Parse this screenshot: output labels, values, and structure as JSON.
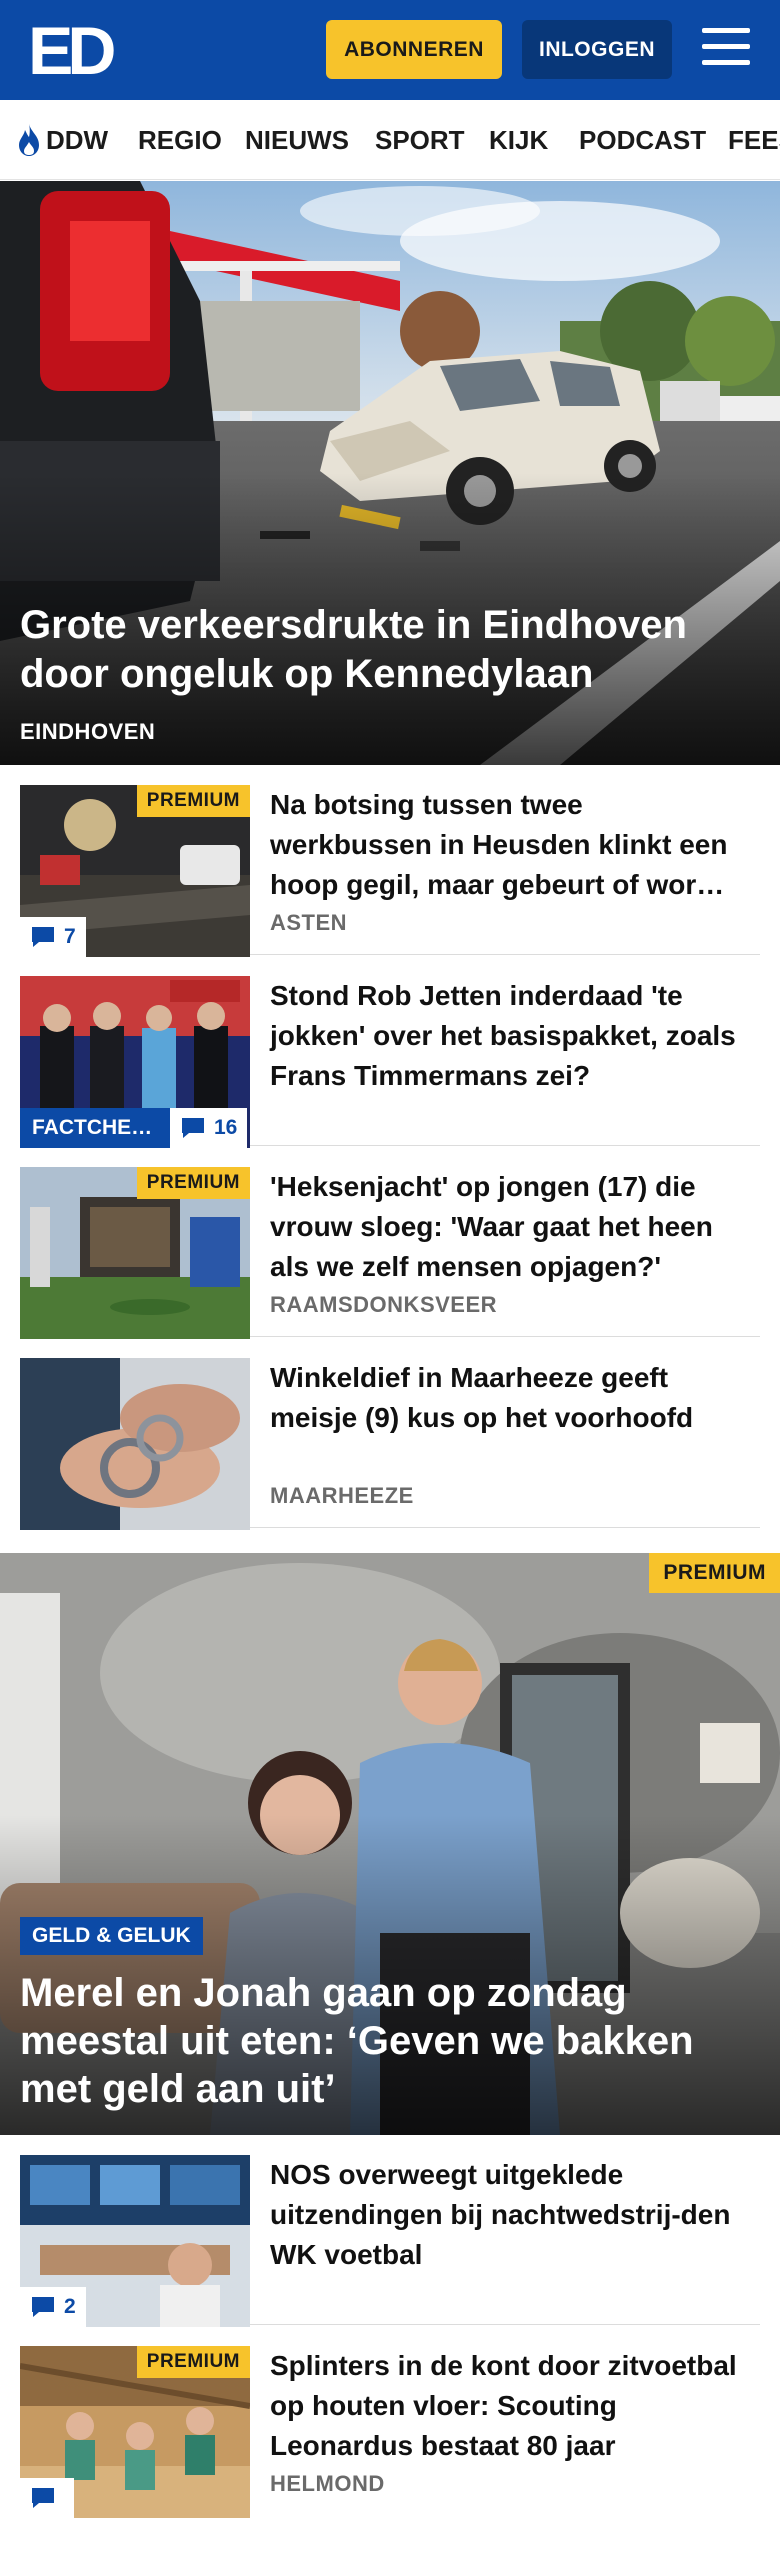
{
  "header": {
    "logo_text": "ED",
    "subscribe_label": "ABONNEREN",
    "login_label": "INLOGGEN"
  },
  "nav": {
    "items": [
      "DDW",
      "REGIO",
      "NIEUWS",
      "SPORT",
      "KIJK",
      "PODCAST",
      "FEEST"
    ]
  },
  "hero": {
    "title": "Grote verkeersdrukte in Eindhoven door ongeluk op Kennedylaan",
    "kicker": "EINDHOVEN"
  },
  "articles": [
    {
      "title": "Na botsing tussen twee werkbussen in Heusden klinkt een hoop gegil, maar gebeurt of wordt er weinig gedaan",
      "location": "ASTEN",
      "premium": "PREMIUM",
      "comments": "7"
    },
    {
      "title": "Stond Rob Jetten inderdaad 'te jokken' over het basispakket, zoals Frans Timmermans zei?",
      "location": "",
      "label": "FACTCHECK",
      "comments": "16"
    },
    {
      "title": "'Heksenjacht' op jongen (17) die vrouw sloeg: 'Waar gaat het heen als we zelf mensen opjagen?'",
      "location": "RAAMSDONKSVEER",
      "premium": "PREMIUM"
    },
    {
      "title": "Winkeldief in Maarheeze geeft meisje (9) kus op het voorhoofd",
      "location": "MAARHEEZE"
    }
  ],
  "feature": {
    "premium": "PREMIUM",
    "tag": "GELD & GELUK",
    "title": "Merel en Jonah gaan op zondag meestal uit eten: ‘Geven we bakken met geld aan uit’"
  },
  "articles2": [
    {
      "title": "NOS overweegt uitgeklede uitzendingen bij nachtwedstrij-den WK voetbal",
      "location": "",
      "comments": "2"
    },
    {
      "title": "Splinters in de kont door zitvoetbal op houten vloer: Scouting Leonardus bestaat 80 jaar",
      "location": "HELMOND",
      "premium": "PREMIUM",
      "comments": ""
    }
  ],
  "colors": {
    "brand_blue": "#0c4aa6",
    "premium_yellow": "#f7c32b",
    "login_blue": "#083779"
  }
}
